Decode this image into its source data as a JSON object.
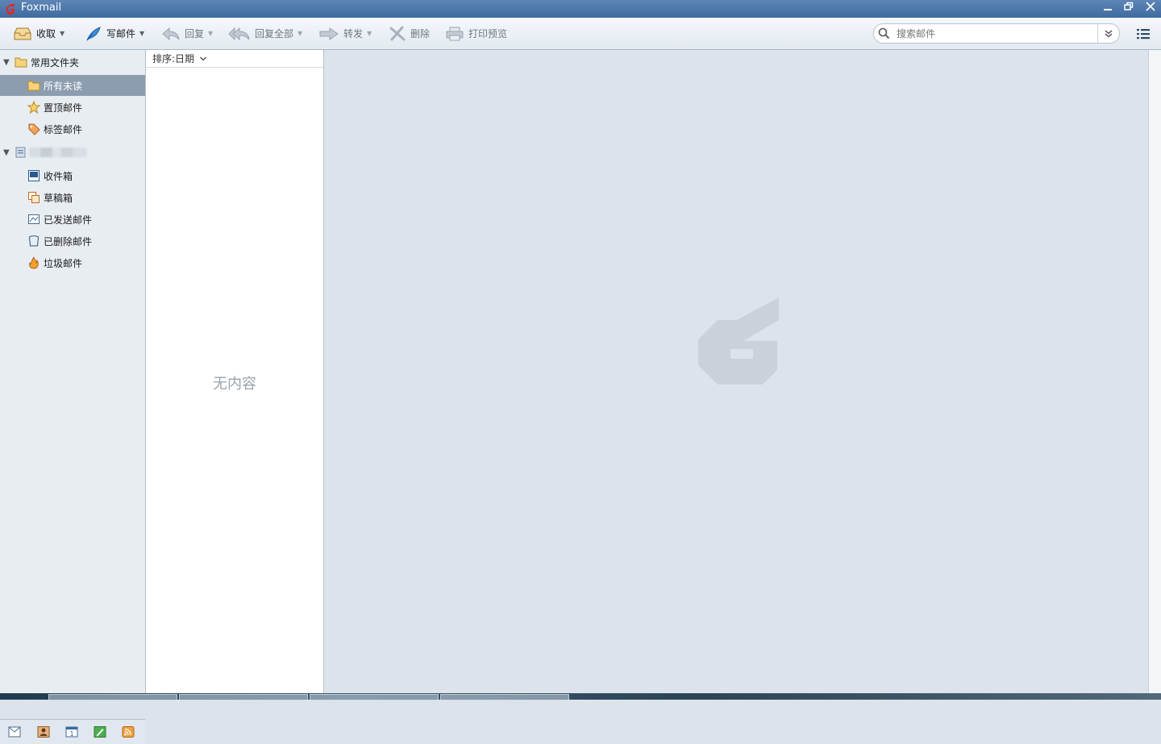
{
  "window": {
    "title": "Foxmail"
  },
  "toolbar": {
    "receive": "收取",
    "compose": "写邮件",
    "reply": "回复",
    "reply_all": "回复全部",
    "forward": "转发",
    "delete": "删除",
    "print_preview": "打印预览"
  },
  "search": {
    "placeholder": "搜索邮件"
  },
  "sidebar": {
    "common_group": "常用文件夹",
    "common_items": [
      {
        "label": "所有未读",
        "icon": "folder-icon",
        "selected": true
      },
      {
        "label": "置顶邮件",
        "icon": "star-icon"
      },
      {
        "label": "标签邮件",
        "icon": "tag-icon"
      }
    ],
    "account_items": [
      {
        "label": "收件箱",
        "icon": "inbox-icon"
      },
      {
        "label": "草稿箱",
        "icon": "drafts-icon"
      },
      {
        "label": "已发送邮件",
        "icon": "sent-icon"
      },
      {
        "label": "已删除邮件",
        "icon": "trash-icon"
      },
      {
        "label": "垃圾邮件",
        "icon": "junk-icon"
      }
    ]
  },
  "maillist": {
    "sort_label": "排序:日期",
    "empty_text": "无内容"
  },
  "colors": {
    "titlebar": "#4a76a8",
    "selected_item": "#8d9db0",
    "reading_pane": "#dde3ea"
  }
}
